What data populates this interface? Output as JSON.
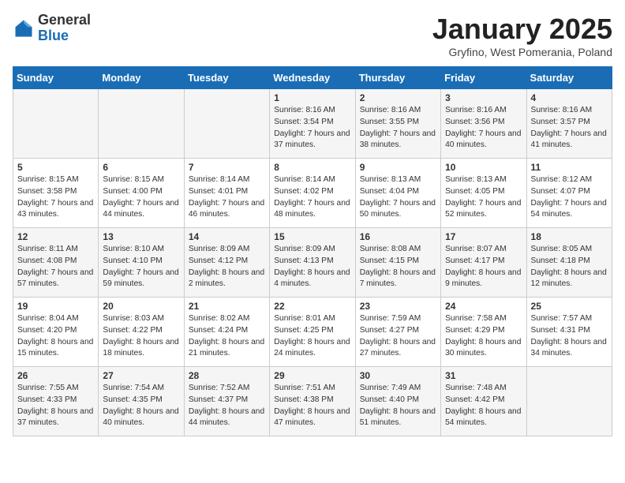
{
  "header": {
    "logo_line1": "General",
    "logo_line2": "Blue",
    "title": "January 2025",
    "subtitle": "Gryfino, West Pomerania, Poland"
  },
  "weekdays": [
    "Sunday",
    "Monday",
    "Tuesday",
    "Wednesday",
    "Thursday",
    "Friday",
    "Saturday"
  ],
  "weeks": [
    [
      {
        "day": "",
        "info": ""
      },
      {
        "day": "",
        "info": ""
      },
      {
        "day": "",
        "info": ""
      },
      {
        "day": "1",
        "info": "Sunrise: 8:16 AM\nSunset: 3:54 PM\nDaylight: 7 hours and 37 minutes."
      },
      {
        "day": "2",
        "info": "Sunrise: 8:16 AM\nSunset: 3:55 PM\nDaylight: 7 hours and 38 minutes."
      },
      {
        "day": "3",
        "info": "Sunrise: 8:16 AM\nSunset: 3:56 PM\nDaylight: 7 hours and 40 minutes."
      },
      {
        "day": "4",
        "info": "Sunrise: 8:16 AM\nSunset: 3:57 PM\nDaylight: 7 hours and 41 minutes."
      }
    ],
    [
      {
        "day": "5",
        "info": "Sunrise: 8:15 AM\nSunset: 3:58 PM\nDaylight: 7 hours and 43 minutes."
      },
      {
        "day": "6",
        "info": "Sunrise: 8:15 AM\nSunset: 4:00 PM\nDaylight: 7 hours and 44 minutes."
      },
      {
        "day": "7",
        "info": "Sunrise: 8:14 AM\nSunset: 4:01 PM\nDaylight: 7 hours and 46 minutes."
      },
      {
        "day": "8",
        "info": "Sunrise: 8:14 AM\nSunset: 4:02 PM\nDaylight: 7 hours and 48 minutes."
      },
      {
        "day": "9",
        "info": "Sunrise: 8:13 AM\nSunset: 4:04 PM\nDaylight: 7 hours and 50 minutes."
      },
      {
        "day": "10",
        "info": "Sunrise: 8:13 AM\nSunset: 4:05 PM\nDaylight: 7 hours and 52 minutes."
      },
      {
        "day": "11",
        "info": "Sunrise: 8:12 AM\nSunset: 4:07 PM\nDaylight: 7 hours and 54 minutes."
      }
    ],
    [
      {
        "day": "12",
        "info": "Sunrise: 8:11 AM\nSunset: 4:08 PM\nDaylight: 7 hours and 57 minutes."
      },
      {
        "day": "13",
        "info": "Sunrise: 8:10 AM\nSunset: 4:10 PM\nDaylight: 7 hours and 59 minutes."
      },
      {
        "day": "14",
        "info": "Sunrise: 8:09 AM\nSunset: 4:12 PM\nDaylight: 8 hours and 2 minutes."
      },
      {
        "day": "15",
        "info": "Sunrise: 8:09 AM\nSunset: 4:13 PM\nDaylight: 8 hours and 4 minutes."
      },
      {
        "day": "16",
        "info": "Sunrise: 8:08 AM\nSunset: 4:15 PM\nDaylight: 8 hours and 7 minutes."
      },
      {
        "day": "17",
        "info": "Sunrise: 8:07 AM\nSunset: 4:17 PM\nDaylight: 8 hours and 9 minutes."
      },
      {
        "day": "18",
        "info": "Sunrise: 8:05 AM\nSunset: 4:18 PM\nDaylight: 8 hours and 12 minutes."
      }
    ],
    [
      {
        "day": "19",
        "info": "Sunrise: 8:04 AM\nSunset: 4:20 PM\nDaylight: 8 hours and 15 minutes."
      },
      {
        "day": "20",
        "info": "Sunrise: 8:03 AM\nSunset: 4:22 PM\nDaylight: 8 hours and 18 minutes."
      },
      {
        "day": "21",
        "info": "Sunrise: 8:02 AM\nSunset: 4:24 PM\nDaylight: 8 hours and 21 minutes."
      },
      {
        "day": "22",
        "info": "Sunrise: 8:01 AM\nSunset: 4:25 PM\nDaylight: 8 hours and 24 minutes."
      },
      {
        "day": "23",
        "info": "Sunrise: 7:59 AM\nSunset: 4:27 PM\nDaylight: 8 hours and 27 minutes."
      },
      {
        "day": "24",
        "info": "Sunrise: 7:58 AM\nSunset: 4:29 PM\nDaylight: 8 hours and 30 minutes."
      },
      {
        "day": "25",
        "info": "Sunrise: 7:57 AM\nSunset: 4:31 PM\nDaylight: 8 hours and 34 minutes."
      }
    ],
    [
      {
        "day": "26",
        "info": "Sunrise: 7:55 AM\nSunset: 4:33 PM\nDaylight: 8 hours and 37 minutes."
      },
      {
        "day": "27",
        "info": "Sunrise: 7:54 AM\nSunset: 4:35 PM\nDaylight: 8 hours and 40 minutes."
      },
      {
        "day": "28",
        "info": "Sunrise: 7:52 AM\nSunset: 4:37 PM\nDaylight: 8 hours and 44 minutes."
      },
      {
        "day": "29",
        "info": "Sunrise: 7:51 AM\nSunset: 4:38 PM\nDaylight: 8 hours and 47 minutes."
      },
      {
        "day": "30",
        "info": "Sunrise: 7:49 AM\nSunset: 4:40 PM\nDaylight: 8 hours and 51 minutes."
      },
      {
        "day": "31",
        "info": "Sunrise: 7:48 AM\nSunset: 4:42 PM\nDaylight: 8 hours and 54 minutes."
      },
      {
        "day": "",
        "info": ""
      }
    ]
  ]
}
